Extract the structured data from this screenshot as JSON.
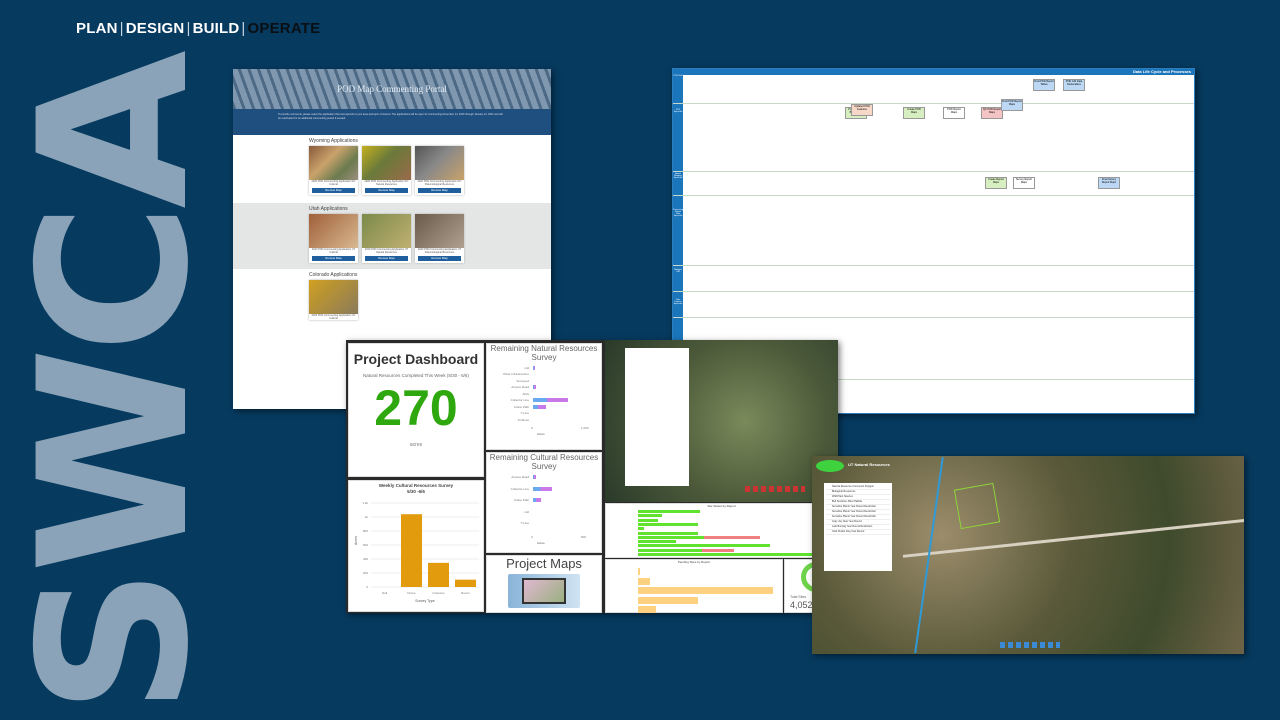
{
  "nav": {
    "items": [
      "PLAN",
      "DESIGN",
      "BUILD",
      "OPERATE"
    ],
    "separator": "|",
    "active": "OPERATE"
  },
  "logo": "SWCA",
  "portal": {
    "title": "POD Map Commenting Portal",
    "intro": "To provide comments, please select the application that corresponds to your area and topic of interest. The applications will be open for commenting November 14, 2020 through January 14, 2021 and will be reactivated for an additional commenting period if needed.",
    "sections": [
      {
        "title": "Wyoming Applications",
        "cards": [
          "2020 POD Commenting Application WY Cultural",
          "2020 POD Commenting Application WY Natural Resources",
          "2020 POD Commenting Application WY Paleontological Resources"
        ]
      },
      {
        "title": "Utah Applications",
        "cards": [
          "2020 POD Commenting Application UT Cultural",
          "2020 POD Commenting Application UT Natural Resources",
          "2020 POD Commenting Application UT Paleontological Resources"
        ]
      },
      {
        "title": "Colorado Applications",
        "cards": [
          "2020 POD Commenting Application CO Cultural"
        ]
      }
    ],
    "button": "Review Map"
  },
  "flowchart": {
    "title": "Data Life Cycle and Processes",
    "lanes": [
      "POD Staff",
      "POD Specialist",
      "Report Mapping Specialist",
      "Processing Report Data Specialist",
      "Biologist GIS",
      "Data Capture Specialist"
    ],
    "boxes": [
      "Produce POD Boundaries",
      "Updated POD Features",
      "Create POD Maps",
      "POD Report Maps",
      "QC POD Report Maps",
      "Final POD Report Maps",
      "Final POD Report Tables",
      "POD GIS Data Deliverables",
      "Create Report Maps",
      "Survey Report Maps",
      "Final Survey Report Maps"
    ]
  },
  "dashboard": {
    "title": "Project Dashboard",
    "subtitle": "Natural Resources Completed This Week (5/30 - 6/6)",
    "value": "270",
    "unit": "acres",
    "natural": {
      "title": "Remaining Natural Resources Survey",
      "categories": [
        "null",
        "Other Infrastructure",
        "Surveyed",
        "Access Road",
        "ADIs",
        "Collector Line",
        "Crane Path",
        "T-Line",
        "Turbines"
      ],
      "values": [
        40,
        0,
        0,
        60,
        0,
        850,
        300,
        0,
        0
      ],
      "ticks": [
        "0",
        "1,000"
      ],
      "xlabel": "Acres"
    },
    "cultural": {
      "title": "Remaining Cultural Resources Survey",
      "categories": [
        "Access Road",
        "Collector Line",
        "Crane Path",
        "null",
        "T-Line"
      ],
      "values": [
        40,
        230,
        90,
        5,
        0
      ],
      "ticks": [
        "0",
        "500"
      ],
      "xlabel": "Acres"
    },
    "weekly": {
      "title": "Weekly Cultural Resources Survey",
      "subtitle": "5/30 -6/6",
      "categories": [
        "Null",
        "Drone",
        "Intensive",
        "Recon"
      ],
      "values": [
        0,
        1040,
        345,
        105
      ],
      "yticks": [
        "0",
        "200",
        "400",
        "600",
        "800",
        "1k",
        "1.2k"
      ],
      "ylabel": "Acres",
      "xlabel": "Survey Type",
      "color": "#e39b0e"
    },
    "maps_label": "Project Maps",
    "site_status_title": "Site Status by Report",
    "pending_title": "Pending Sites by Report",
    "total_label": "Total Sites",
    "total": "4,052"
  },
  "satellite": {
    "app_title": "UT Natural Resources",
    "layers": [
      "Natural Resource Comments Polygon",
      "Biological Resources",
      "Wild Plant Species",
      "Bull Sensitive Plant Habitat",
      "Sensitive Plants Year Round Restriction",
      "Sensitive Plants Year Round Restriction",
      "Sensitive Plants Year Round Restriction",
      "Gray Jay Nest Year Round",
      "Lark Bunting Year Round Restriction",
      "Utah Prairie Dog Year Round"
    ]
  }
}
